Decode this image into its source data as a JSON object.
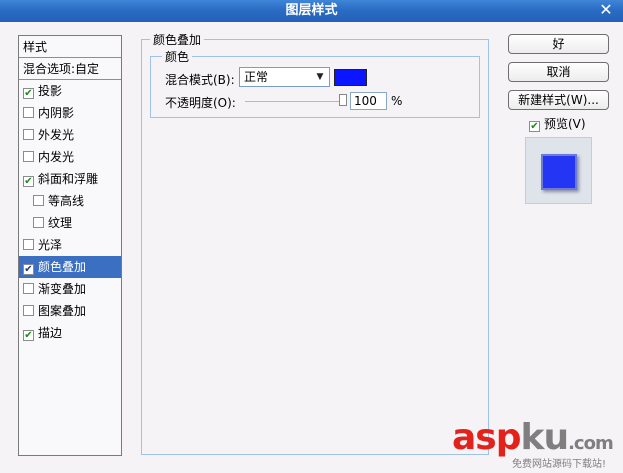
{
  "window": {
    "title": "图层样式",
    "close_glyph": "✕"
  },
  "style_list": {
    "header": "样式",
    "blend_options": "混合选项:自定",
    "items": [
      {
        "label": "投影",
        "checked": true
      },
      {
        "label": "内阴影",
        "checked": false
      },
      {
        "label": "外发光",
        "checked": false
      },
      {
        "label": "内发光",
        "checked": false
      },
      {
        "label": "斜面和浮雕",
        "checked": true
      },
      {
        "label": "等高线",
        "checked": false,
        "sub": true
      },
      {
        "label": "纹理",
        "checked": false,
        "sub": true
      },
      {
        "label": "光泽",
        "checked": false
      },
      {
        "label": "颜色叠加",
        "checked": true,
        "selected": true
      },
      {
        "label": "渐变叠加",
        "checked": false
      },
      {
        "label": "图案叠加",
        "checked": false
      },
      {
        "label": "描边",
        "checked": true
      }
    ]
  },
  "panel": {
    "group_title": "颜色叠加",
    "subgroup_title": "颜色",
    "blend_mode_label": "混合模式(B):",
    "blend_mode_value": "正常",
    "overlay_color": "#0b15ff",
    "opacity_label": "不透明度(O):",
    "opacity_value": "100",
    "opacity_unit": "%"
  },
  "buttons": {
    "ok": "好",
    "cancel": "取消",
    "new_style": "新建样式(W)...",
    "preview_label": "预览(V)",
    "preview_checked": true
  },
  "watermark": {
    "part1": "asp",
    "part2": "ku",
    "part3": ".com",
    "sub": "免费网站源码下载站!"
  }
}
